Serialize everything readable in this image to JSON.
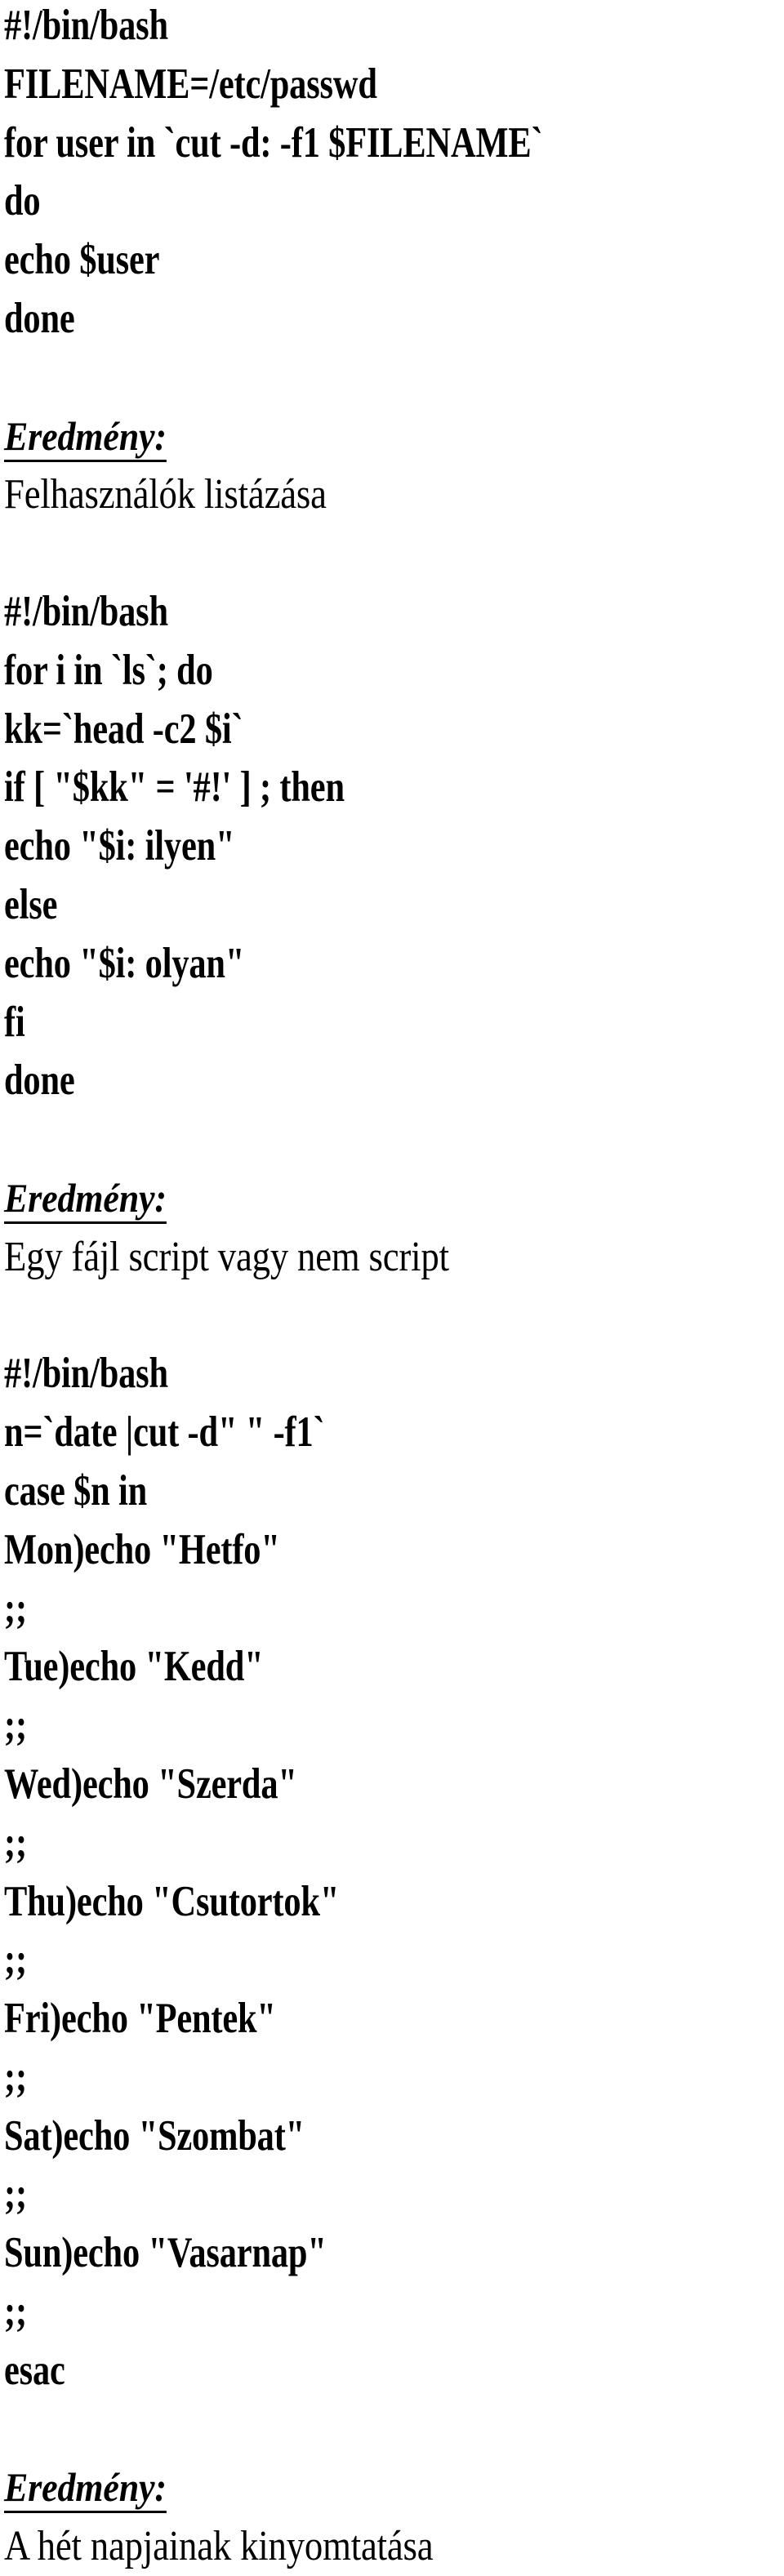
{
  "document": {
    "language": "hu",
    "kind": "bash-script-notes",
    "background_color": "#ffffff",
    "text_color": "#000000",
    "result_heading": "Eredmény:",
    "blocks": [
      {
        "id": "block-1",
        "topic": "felhasznalok-listazasa",
        "code_lines": [
          "#!/bin/bash",
          "FILENAME=/etc/passwd",
          "for user in `cut -d: -f1 $FILENAME`",
          "do",
          "echo $user",
          "done"
        ],
        "result_label": "Eredmény:",
        "result_text": "Felhasználók listázása"
      },
      {
        "id": "block-2",
        "topic": "script-vagy-nem-script",
        "code_lines": [
          "#!/bin/bash",
          "for i in `ls`; do",
          "kk=`head -c2 $i`",
          "if [ \"$kk\" = '#!' ] ; then",
          "echo \"$i: ilyen\"",
          "else",
          "echo \"$i: olyan\"",
          "fi",
          "done"
        ],
        "result_label": "Eredmény:",
        "result_text": "Egy fájl script vagy nem script"
      },
      {
        "id": "block-3",
        "topic": "het-napjai",
        "code_lines": [
          "#!/bin/bash",
          "n=`date |cut -d\" \" -f1`",
          "case $n in",
          "Mon)echo \"Hetfo\"",
          ";;",
          "Tue)echo \"Kedd\"",
          ";;",
          "Wed)echo \"Szerda\"",
          ";;",
          "Thu)echo \"Csutortok\"",
          ";;",
          "Fri)echo \"Pentek\"",
          ";;",
          "Sat)echo \"Szombat\"",
          ";;",
          "Sun)echo \"Vasarnap\"",
          ";;",
          "esac"
        ],
        "result_label": "Eredmény:",
        "result_text": "A hét napjainak kinyomtatása"
      }
    ]
  }
}
